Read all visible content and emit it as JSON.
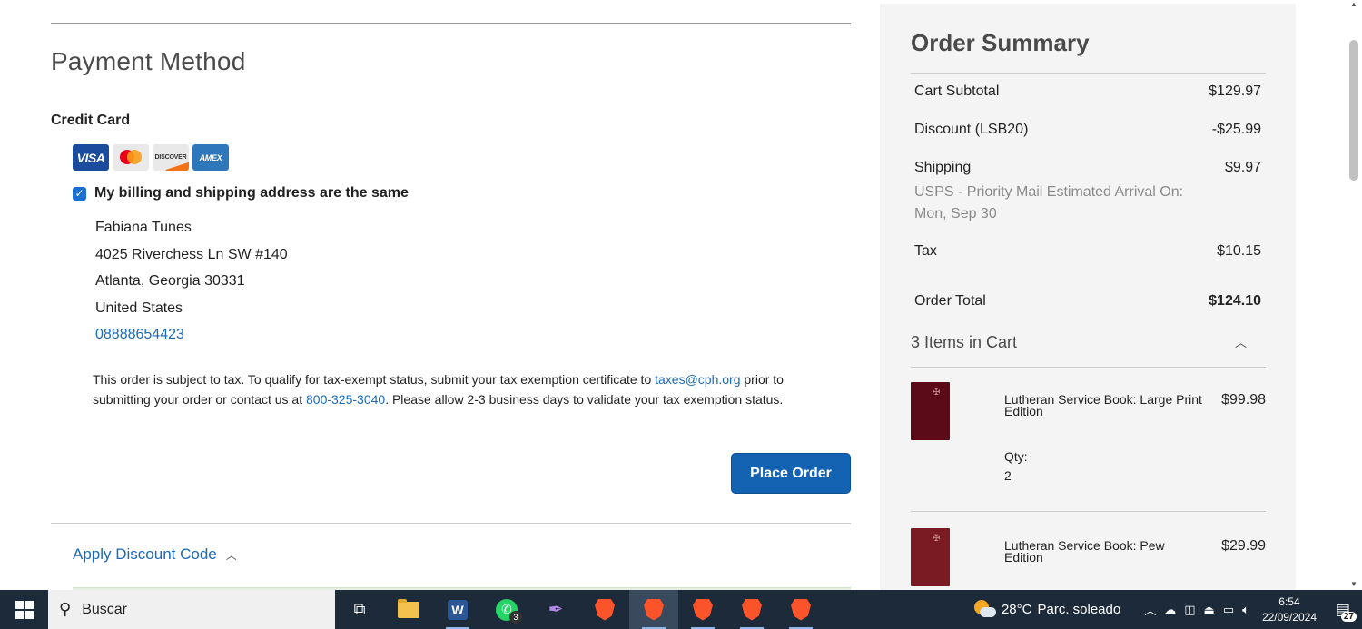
{
  "payment": {
    "title": "Payment Method",
    "credit_card_label": "Credit Card",
    "cards": [
      "VISA",
      "MasterCard",
      "DISCOVER",
      "AMEX"
    ],
    "same_address_label": "My billing and shipping address are the same",
    "same_address_checked": true,
    "address": {
      "name": "Fabiana Tunes",
      "street": "4025 Riverchess Ln SW #140",
      "city_line": "Atlanta, Georgia 30331",
      "country": "United States",
      "phone": "08888654423"
    },
    "tax_note": {
      "part1": "This order is subject to tax. To qualify for tax-exempt status, submit your tax exemption certificate to ",
      "email": "taxes@cph.org",
      "part2": " prior to submitting your order or contact us at ",
      "phone": "800-325-3040",
      "part3": ". Please allow 2-3 business days to validate your tax exemption status."
    },
    "place_order_label": "Place Order",
    "discount_toggle_label": "Apply Discount Code"
  },
  "summary": {
    "title": "Order Summary",
    "subtotal_label": "Cart Subtotal",
    "subtotal_value": "$129.97",
    "discount_label": "Discount (LSB20)",
    "discount_value": "-$25.99",
    "shipping_label": "Shipping",
    "shipping_value": "$9.97",
    "shipping_method": "USPS - Priority Mail Estimated Arrival On: Mon, Sep 30",
    "tax_label": "Tax",
    "tax_value": "$10.15",
    "total_label": "Order Total",
    "total_value": "$124.10",
    "items_heading": "3 Items in Cart",
    "items": [
      {
        "name": "Lutheran Service Book: Large Print Edition",
        "price": "$99.98",
        "qty_label": "Qty:",
        "qty": "2",
        "cover_color": "#5b0a18"
      },
      {
        "name": "Lutheran Service Book: Pew Edition",
        "price": "$29.99",
        "cover_color": "#7a1a22"
      }
    ]
  },
  "taskbar": {
    "search_placeholder": "Buscar",
    "whatsapp_badge": "3",
    "weather_temp": "28°C",
    "weather_desc": "Parc. soleado",
    "time": "6:54",
    "date": "22/09/2024",
    "notifications": "27"
  }
}
